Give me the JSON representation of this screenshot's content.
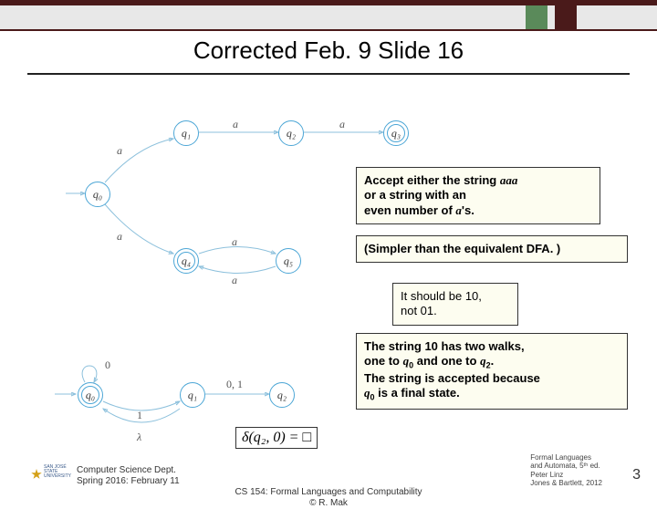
{
  "title": "Corrected Feb. 9 Slide 16",
  "states_top": {
    "q0": "q₀",
    "q1": "q₁",
    "q2": "q₂",
    "q3": "q₃",
    "q4": "q₄",
    "q5": "q₅"
  },
  "labels_top": {
    "a1": "a",
    "a2": "a",
    "a3": "a",
    "a4": "a",
    "a5": "a",
    "a6": "a",
    "a7": "a"
  },
  "box_accept": {
    "l1": "Accept either the string ",
    "l1i": "aaa",
    "l2": "or a string with an",
    "l3": "even number of ",
    "l3i": "a",
    "l3t": "'s."
  },
  "box_simpler": "(Simpler than the equivalent DFA. )",
  "box_correction": {
    "l1": "It should be 10,",
    "l2": "not 01."
  },
  "box_walks": {
    "l1a": "The string ",
    "l1b": "10",
    "l1c": " has two walks,",
    "l2a": "one to ",
    "l2b": "q",
    "l2bs": "0",
    "l2c": " and one to ",
    "l2d": "q",
    "l2ds": "2",
    "l2e": ".",
    "l3": "The string is accepted because",
    "l4a": "q",
    "l4as": "0",
    "l4b": " is a final state."
  },
  "states_bot": {
    "q0": "q₀",
    "q1": "q₁",
    "q2": "q₂"
  },
  "labels_bot": {
    "zero1": "0",
    "one": "1",
    "zero_one": "0, 1",
    "lambda": "λ"
  },
  "equation": "δ(q₂, 0) = □",
  "footer": {
    "dept1": "Computer Science Dept.",
    "dept2": "Spring 2016: February 11",
    "center1": "CS 154: Formal Languages and Computability",
    "center2": "© R. Mak",
    "ref1": "Formal Languages",
    "ref2": "and Automata, 5ᵗʰ ed.",
    "ref3": "Peter Linz",
    "ref4": "Jones & Bartlett, 2012",
    "page": "3",
    "logo": "SAN JOSÉ STATE\nUNIVERSITY"
  }
}
